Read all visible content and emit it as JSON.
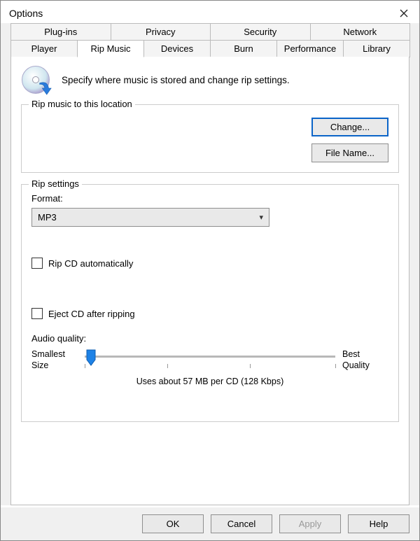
{
  "window": {
    "title": "Options"
  },
  "tabs_row1": [
    {
      "label": "Plug-ins"
    },
    {
      "label": "Privacy"
    },
    {
      "label": "Security"
    },
    {
      "label": "Network"
    }
  ],
  "tabs_row2": [
    {
      "label": "Player"
    },
    {
      "label": "Rip Music",
      "active": true
    },
    {
      "label": "Devices"
    },
    {
      "label": "Burn"
    },
    {
      "label": "Performance"
    },
    {
      "label": "Library"
    }
  ],
  "intro": "Specify where music is stored and change rip settings.",
  "location_box": {
    "legend": "Rip music to this location",
    "change_btn": "Change...",
    "filename_btn": "File Name..."
  },
  "rip_box": {
    "legend": "Rip settings",
    "format_label": "Format:",
    "format_selected": "MP3",
    "rip_auto_label": "Rip CD automatically",
    "eject_label": "Eject CD after ripping",
    "aq_label": "Audio quality:",
    "slider_left_line1": "Smallest",
    "slider_left_line2": "Size",
    "slider_right_line1": "Best",
    "slider_right_line2": "Quality",
    "usage": "Uses about 57 MB per CD (128 Kbps)"
  },
  "footer": {
    "ok": "OK",
    "cancel": "Cancel",
    "apply": "Apply",
    "help": "Help"
  }
}
